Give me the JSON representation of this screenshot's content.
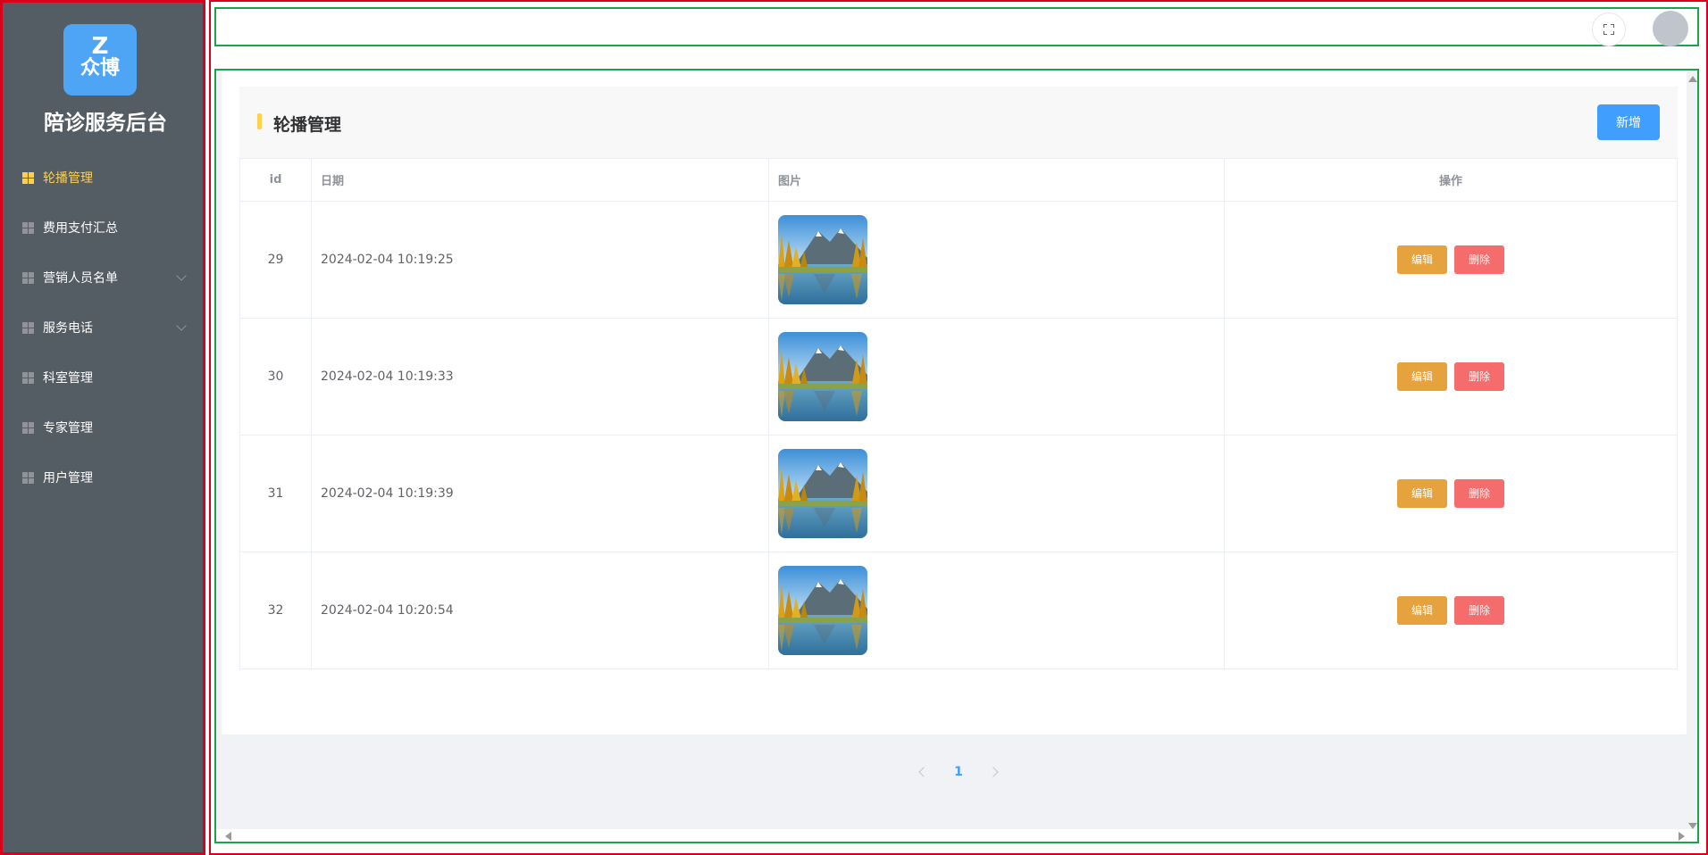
{
  "sidebar": {
    "logo_letter": "Z",
    "logo_text": "众博",
    "title": "陪诊服务后台",
    "items": [
      {
        "label": "轮播管理",
        "active": true,
        "has_submenu": false
      },
      {
        "label": "费用支付汇总",
        "active": false,
        "has_submenu": false
      },
      {
        "label": "营销人员名单",
        "active": false,
        "has_submenu": true
      },
      {
        "label": "服务电话",
        "active": false,
        "has_submenu": true
      },
      {
        "label": "科室管理",
        "active": false,
        "has_submenu": false
      },
      {
        "label": "专家管理",
        "active": false,
        "has_submenu": false
      },
      {
        "label": "用户管理",
        "active": false,
        "has_submenu": false
      }
    ]
  },
  "header": {
    "fullscreen_icon": "fullscreen-icon",
    "avatar": "user-avatar"
  },
  "page": {
    "title": "轮播管理",
    "add_label": "新增"
  },
  "table": {
    "columns": [
      "id",
      "日期",
      "图片",
      "操作"
    ],
    "rows": [
      {
        "id": "29",
        "date": "2024-02-04 10:19:25",
        "image": "landscape-thumbnail"
      },
      {
        "id": "30",
        "date": "2024-02-04 10:19:33",
        "image": "landscape-thumbnail"
      },
      {
        "id": "31",
        "date": "2024-02-04 10:19:39",
        "image": "landscape-thumbnail"
      },
      {
        "id": "32",
        "date": "2024-02-04 10:20:54",
        "image": "landscape-thumbnail"
      }
    ],
    "edit_label": "编辑",
    "delete_label": "删除"
  },
  "pagination": {
    "current_page": "1"
  },
  "colors": {
    "sidebar_bg": "#545c64",
    "active": "#ffd04b",
    "primary": "#409eff",
    "warning": "#e6a23c",
    "danger": "#f56c6c"
  }
}
